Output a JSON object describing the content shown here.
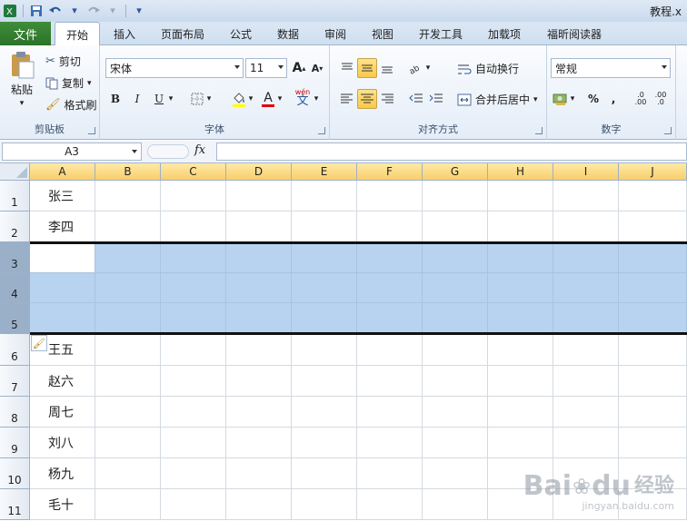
{
  "window": {
    "title": "教程.x"
  },
  "tabs": {
    "file": "文件",
    "items": [
      "开始",
      "插入",
      "页面布局",
      "公式",
      "数据",
      "审阅",
      "视图",
      "开发工具",
      "加载项",
      "福昕阅读器"
    ]
  },
  "ribbon": {
    "clipboard": {
      "label": "剪贴板",
      "paste": "粘贴",
      "cut": "剪切",
      "copy": "复制",
      "format_painter": "格式刷"
    },
    "font": {
      "label": "字体",
      "name": "宋体",
      "size": "11",
      "bold": "B",
      "italic": "I",
      "underline": "U",
      "grow": "A",
      "shrink": "A",
      "wen": "wén",
      "wen2": "文",
      "font_color": "A"
    },
    "alignment": {
      "label": "对齐方式",
      "wrap": "自动换行",
      "merge": "合并后居中"
    },
    "number": {
      "label": "数字",
      "format": "常规",
      "percent": "%",
      "comma": ",",
      "inc": ".00",
      "dec": ".0"
    }
  },
  "formula_bar": {
    "name_box": "A3",
    "fx": "fx",
    "value": ""
  },
  "sheet": {
    "columns": [
      "A",
      "B",
      "C",
      "D",
      "E",
      "F",
      "G",
      "H",
      "I",
      "J"
    ],
    "rows": [
      {
        "num": "1",
        "a": "张三"
      },
      {
        "num": "2",
        "a": "李四"
      },
      {
        "num": "3",
        "a": ""
      },
      {
        "num": "4",
        "a": ""
      },
      {
        "num": "5",
        "a": ""
      },
      {
        "num": "6",
        "a": "王五"
      },
      {
        "num": "7",
        "a": "赵六"
      },
      {
        "num": "8",
        "a": "周七"
      },
      {
        "num": "9",
        "a": "刘八"
      },
      {
        "num": "10",
        "a": "杨九"
      },
      {
        "num": "11",
        "a": "毛十"
      }
    ]
  },
  "watermark": {
    "brand": "Bai",
    "logo": "du",
    "cn": "经验",
    "url": "jingyan.baidu.com"
  },
  "colors": {
    "file_tab": "#2b7329",
    "selection": "#b8d3f0",
    "header_selected": "#f8cf6a"
  }
}
